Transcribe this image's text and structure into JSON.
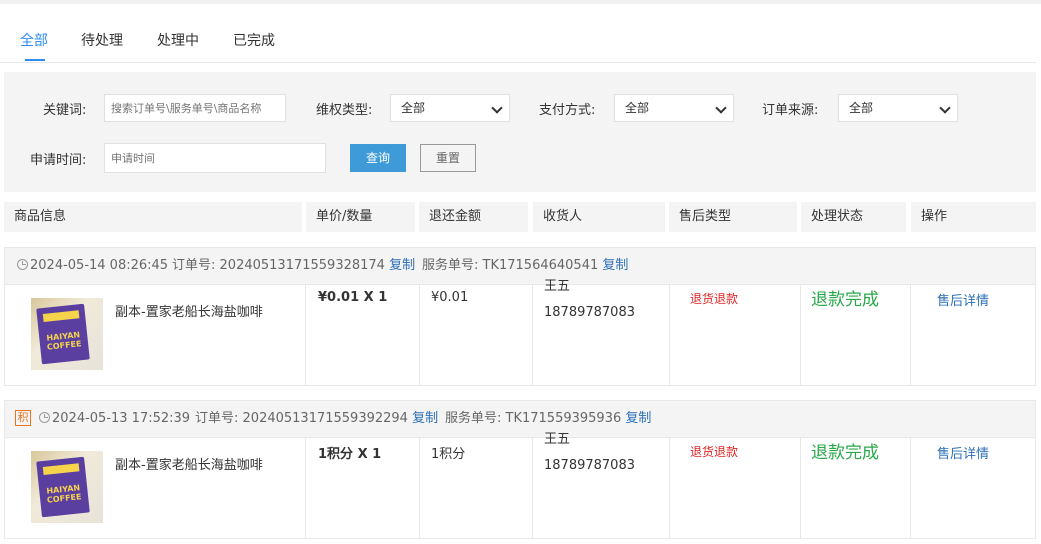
{
  "tabs": [
    "全部",
    "待处理",
    "处理中",
    "已完成"
  ],
  "filter": {
    "keyword_label": "关键词:",
    "keyword_placeholder": "搜索订单号\\服务单号\\商品名称",
    "rights_type_label": "维权类型:",
    "rights_type_value": "全部",
    "pay_method_label": "支付方式:",
    "pay_method_value": "全部",
    "order_source_label": "订单来源:",
    "order_source_value": "全部",
    "apply_time_label": "申请时间:",
    "apply_time_placeholder": "申请时间",
    "query_button": "查询",
    "reset_button": "重置"
  },
  "table": {
    "headers": [
      "商品信息",
      "单价/数量",
      "退还金额",
      "收货人",
      "售后类型",
      "处理状态",
      "操作"
    ]
  },
  "orders": [
    {
      "badge": "",
      "time": "2024-05-14 08:26:45",
      "order_label": "订单号:",
      "order_no": "20240513171559328174",
      "service_label": "服务单号:",
      "service_no": "TK171564640541",
      "copy": "复制",
      "product_name": "副本-置家老船长海盐咖啡",
      "product_image_text": "HAIYAN COFFEE",
      "price_qty": "¥0.01 X 1",
      "refund": "¥0.01",
      "receiver_name": "王五",
      "receiver_phone": "18789787083",
      "after_sale_type": "退货退款",
      "status": "退款完成",
      "action": "售后详情"
    },
    {
      "badge": "积",
      "time": "2024-05-13 17:52:39",
      "order_label": "订单号:",
      "order_no": "20240513171559392294",
      "service_label": "服务单号:",
      "service_no": "TK171559395936",
      "copy": "复制",
      "product_name": "副本-置家老船长海盐咖啡",
      "product_image_text": "HAIYAN COFFEE",
      "price_qty": "1积分 X 1",
      "refund": "1积分",
      "receiver_name": "王五",
      "receiver_phone": "18789787083",
      "after_sale_type": "退货退款",
      "status": "退款完成",
      "action": "售后详情"
    }
  ],
  "colors": {
    "accent": "#2d8cf0",
    "query_button": "#3e9bd8",
    "status_green": "#2aa94a",
    "type_red": "#e02424",
    "link_blue": "#2d6fb5",
    "points_badge": "#e8741f"
  }
}
